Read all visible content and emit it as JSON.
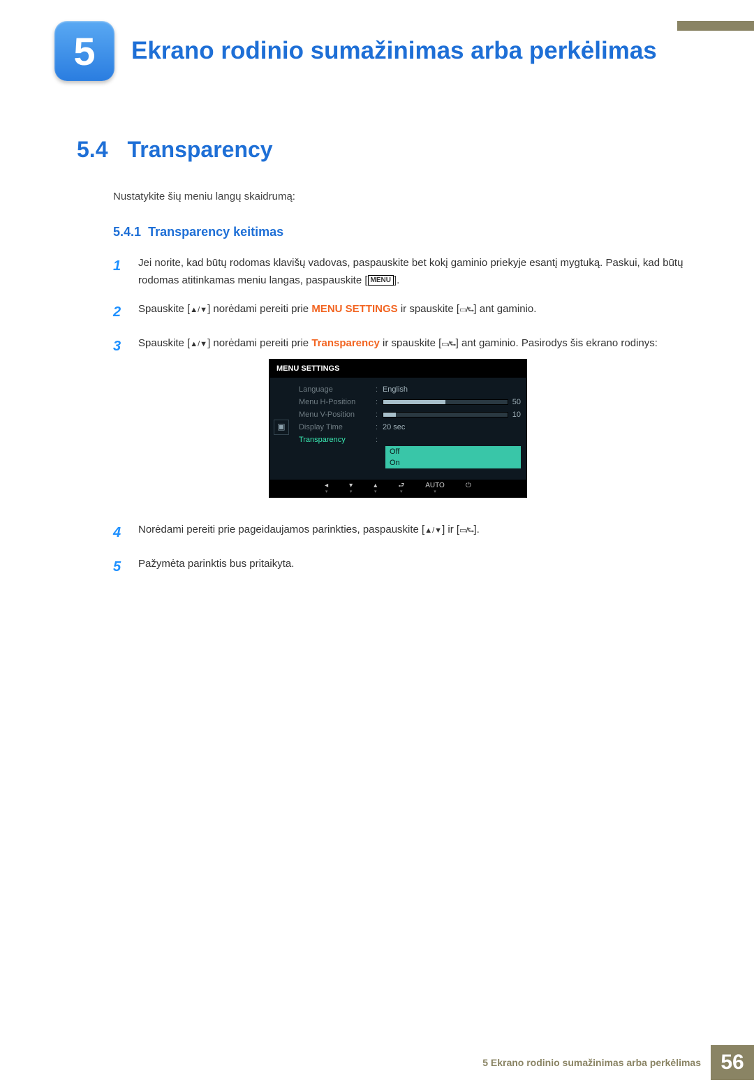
{
  "chapter": {
    "number": "5",
    "title": "Ekrano rodinio sumažinimas arba perkėlimas"
  },
  "section": {
    "num": "5.4",
    "title": "Transparency",
    "intro": "Nustatykite šių meniu langų skaidrumą:"
  },
  "subsection": {
    "num": "5.4.1",
    "title": "Transparency keitimas"
  },
  "steps": {
    "s1": "Jei norite, kad būtų rodomas klavišų vadovas, paspauskite bet kokį gaminio priekyje esantį mygtuką. Paskui, kad būtų rodomas atitinkamas meniu langas, paspauskite [",
    "s1b": "].",
    "s2a": "Spauskite [",
    "s2b": "] norėdami pereiti prie ",
    "s2c": "MENU SETTINGS",
    "s2d": " ir spauskite [",
    "s2e": "] ant gaminio.",
    "s3a": "Spauskite [",
    "s3b": "] norėdami pereiti prie ",
    "s3c": "Transparency",
    "s3d": " ir spauskite [",
    "s3e": "] ant gaminio. Pasirodys šis ekrano rodinys:",
    "s4a": "Norėdami pereiti prie pageidaujamos parinkties, paspauskite [",
    "s4b": "] ir [",
    "s4c": "].",
    "s5": "Pažymėta parinktis bus pritaikyta."
  },
  "menuKey": "MENU",
  "osd": {
    "title": "MENU SETTINGS",
    "rows": {
      "lang": {
        "label": "Language",
        "value": "English"
      },
      "h": {
        "label": "Menu H-Position",
        "value": "50"
      },
      "v": {
        "label": "Menu V-Position",
        "value": "10"
      },
      "dt": {
        "label": "Display Time",
        "value": "20 sec"
      },
      "tr": {
        "label": "Transparency"
      }
    },
    "opts": {
      "off": "Off",
      "on": "On"
    },
    "controls": {
      "auto": "AUTO"
    }
  },
  "footer": {
    "text": "5 Ekrano rodinio sumažinimas arba perkėlimas",
    "page": "56"
  }
}
